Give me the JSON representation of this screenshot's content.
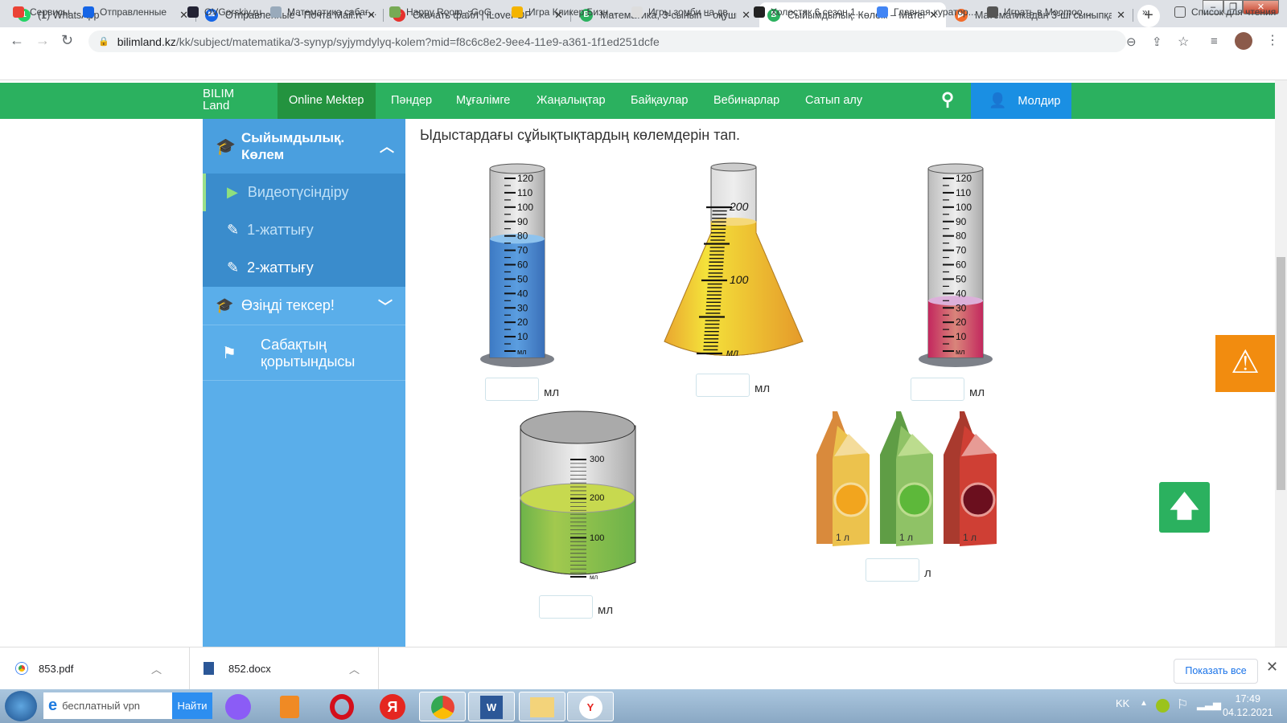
{
  "browser": {
    "tabs": [
      {
        "title": "(1) WhatsApp",
        "icon": "whatsapp-icon",
        "color": "#25d366",
        "glyph": "1"
      },
      {
        "title": "Отправленные - Почта Mail.ru",
        "icon": "mail-icon",
        "color": "#1565e6",
        "glyph": "✉"
      },
      {
        "title": "Скачать файл | iLovePDF",
        "icon": "ilovepdf-icon",
        "color": "#e5322d",
        "glyph": "♥"
      },
      {
        "title": "Математика, 3-сынып – оқушы",
        "icon": "bilimland-icon",
        "color": "#2bb15f",
        "glyph": "B"
      },
      {
        "title": "Сыйымдылық. Көлем – Матема",
        "icon": "bilimland-icon",
        "color": "#2bb15f",
        "glyph": "B"
      },
      {
        "title": "Математикадан 3-ші сыныпқа",
        "icon": "slides-icon",
        "color": "#f26b2a",
        "glyph": "▶"
      }
    ],
    "active_tab": 4,
    "url_host": "bilimland.kz",
    "url_path": "/kk/subject/matematika/3-synyp/syjymdylyq-kolem?mid=f8c6c8e2-9ee4-11e9-a361-1f1ed251dcfe",
    "bookmarks": [
      {
        "label": "Сервисы",
        "color": "#ea4335"
      },
      {
        "label": "Отправленные",
        "color": "#1565e6"
      },
      {
        "label": "OVGorskiy.ru",
        "color": "#223"
      },
      {
        "label": "Математика сабағ...",
        "color": "#9ab"
      },
      {
        "label": "Happy Room - GoG...",
        "color": "#7a5"
      },
      {
        "label": "Игра Кликер Бизн...",
        "color": "#f4b400"
      },
      {
        "label": "Игры зомби на дв...",
        "color": "#ddd"
      },
      {
        "label": "Холостяк 6 сезон 1...",
        "color": "#222"
      },
      {
        "label": "Главная-куратор...",
        "color": "#4285f4"
      },
      {
        "label": "Играть в Moomoo....",
        "color": "#555"
      }
    ],
    "bookmarks_more": "»",
    "reading_list": "Список для чтения"
  },
  "site": {
    "logo": [
      "BILIM",
      "Land"
    ],
    "nav": [
      "Online Mektep",
      "Пәндер",
      "Мұғалімге",
      "Жаңалықтар",
      "Байқаулар",
      "Вебинарлар",
      "Сатып алу"
    ],
    "user": "Молдир",
    "colors": {
      "green": "#2bb15f",
      "blue": "#1a8fe3",
      "sidebar": "#5aaeea"
    }
  },
  "sidebar": {
    "section_title": "Сыйымдылық. Көлем",
    "items": [
      "Видеотүсіндіру",
      "1-жаттығу",
      "2-жаттығу"
    ],
    "check": "Өзіңді тексер!",
    "summary": "Сабақтың қорытындысы"
  },
  "task": {
    "instruction": "Ыдыстардағы сұйықтықтардың көлемдерін тап.",
    "cyl_labels": [
      "120",
      "110",
      "100",
      "90",
      "80",
      "70",
      "60",
      "50",
      "40",
      "30",
      "20",
      "10",
      "мл"
    ],
    "flask_labels": [
      "200",
      "100",
      "мл"
    ],
    "beaker_labels": [
      "300",
      "200",
      "100",
      "мл"
    ],
    "juice_label": "1 л",
    "unit_ml": "мл",
    "unit_l": "л",
    "levels": {
      "cylinder1": 78,
      "flask": 180,
      "cylinder2": 35,
      "beaker": 200
    }
  },
  "downloads": {
    "files": [
      "853.pdf",
      "852.docx"
    ],
    "show_all": "Показать все"
  },
  "taskbar": {
    "search": "бесплатный vpn",
    "search_btn": "Найти",
    "lang": "KK",
    "time": "17:49",
    "date": "04.12.2021"
  }
}
